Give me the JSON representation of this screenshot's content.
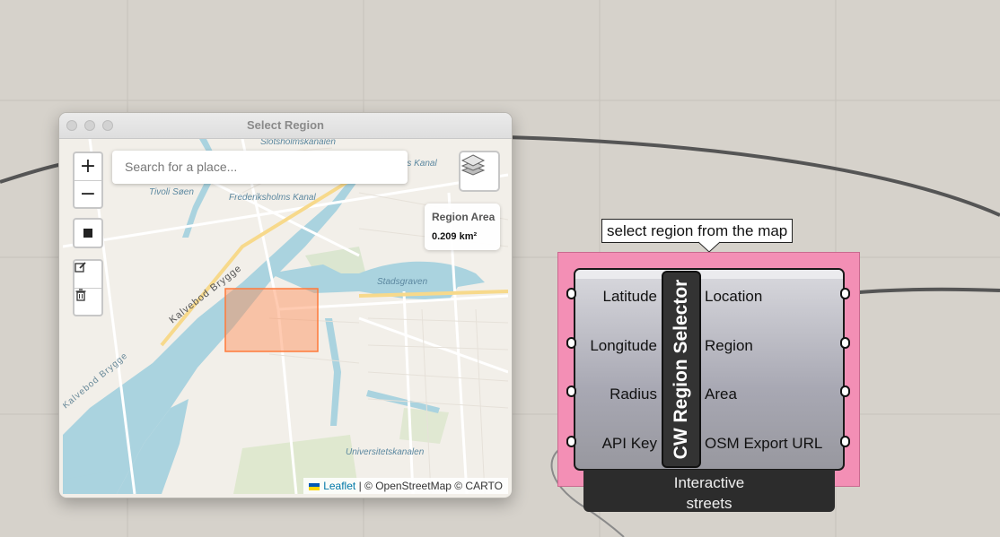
{
  "window": {
    "title": "Select Region"
  },
  "map": {
    "search_placeholder": "Search for a place...",
    "zoom_in": "+",
    "zoom_out": "−",
    "region_area_title": "Region Area",
    "region_area_value": "0.209 km²",
    "labels": {
      "slotsholmskanalen": "Slotsholmskanalen",
      "frederiksholms_kanal": "Frederiksholms Kanal",
      "tivoli_soen": "Tivoli Søen",
      "kalvebod_brygge": "Kalvebod Brygge",
      "kalvebod_brygge_2": "Kalvebod Brygge",
      "stadsgraven": "Stadsgraven",
      "universitetskanalen": "Universitetskanalen",
      "christianshavns_kanal": "rs Kanal"
    },
    "attribution": {
      "leaflet": "Leaflet",
      "rest": " | © OpenStreetMap © CARTO"
    },
    "colors": {
      "land": "#f2efe9",
      "water": "#aad3df",
      "selection": "#ff8c55"
    }
  },
  "component": {
    "tooltip": "select region from the map",
    "nickname": "CW Region Selector",
    "inputs": [
      "Latitude",
      "Longitude",
      "Radius",
      "API Key"
    ],
    "outputs": [
      "Location",
      "Region",
      "Area",
      "OSM Export URL"
    ],
    "footer_line1": "Interactive",
    "footer_line2": "streets",
    "colors": {
      "panel": "#f38fb5",
      "body": "#a8a8b3",
      "nickname_bar": "#333333"
    }
  }
}
